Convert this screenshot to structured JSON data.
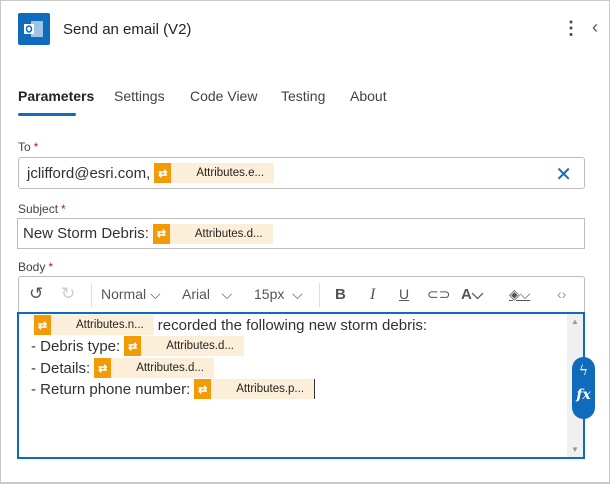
{
  "header": {
    "title": "Send an email (V2)",
    "app_icon": "outlook-icon",
    "more_icon": "more-vertical-icon",
    "collapse_icon": "chevron-left-icon"
  },
  "tabs": [
    {
      "label": "Parameters",
      "active": true
    },
    {
      "label": "Settings"
    },
    {
      "label": "Code View"
    },
    {
      "label": "Testing"
    },
    {
      "label": "About"
    }
  ],
  "fields": {
    "to": {
      "label": "To",
      "required": "*",
      "text": "jclifford@esri.com,",
      "token": "Attributes.e..."
    },
    "subject": {
      "label": "Subject",
      "required": "*",
      "text": "New Storm Debris:",
      "token": "Attributes.d..."
    },
    "body": {
      "label": "Body",
      "required": "*"
    }
  },
  "toolbar": {
    "style": "Normal",
    "font": "Arial",
    "size": "15px"
  },
  "body_lines": [
    {
      "prefix": "",
      "token": "Attributes.n...",
      "suffix": " recorded the following new storm debris:"
    },
    {
      "prefix": "- Debris type:",
      "token": "Attributes.d...",
      "suffix": ""
    },
    {
      "prefix": "- Details:",
      "token": "Attributes.d...",
      "suffix": ""
    },
    {
      "prefix": "- Return phone number:",
      "token": "Attributes.p...",
      "suffix": ""
    }
  ],
  "colors": {
    "accent": "#0f6cbd",
    "token": "#f29b05",
    "token_bg": "#fcefd9"
  }
}
